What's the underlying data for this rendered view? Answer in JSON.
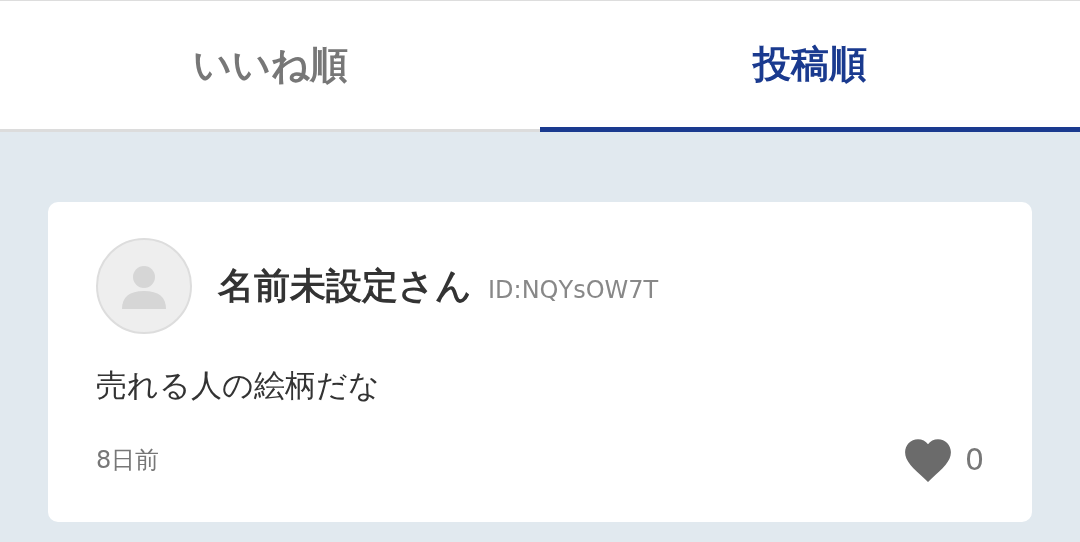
{
  "tabs": [
    {
      "label": "いいね順",
      "selected": false
    },
    {
      "label": "投稿順",
      "selected": true
    }
  ],
  "comments": [
    {
      "author": "名前未設定さん",
      "user_id": "ID:NQYsOW7T",
      "body": "売れる人の絵柄だな",
      "time": "8日前",
      "likes": "0"
    }
  ]
}
